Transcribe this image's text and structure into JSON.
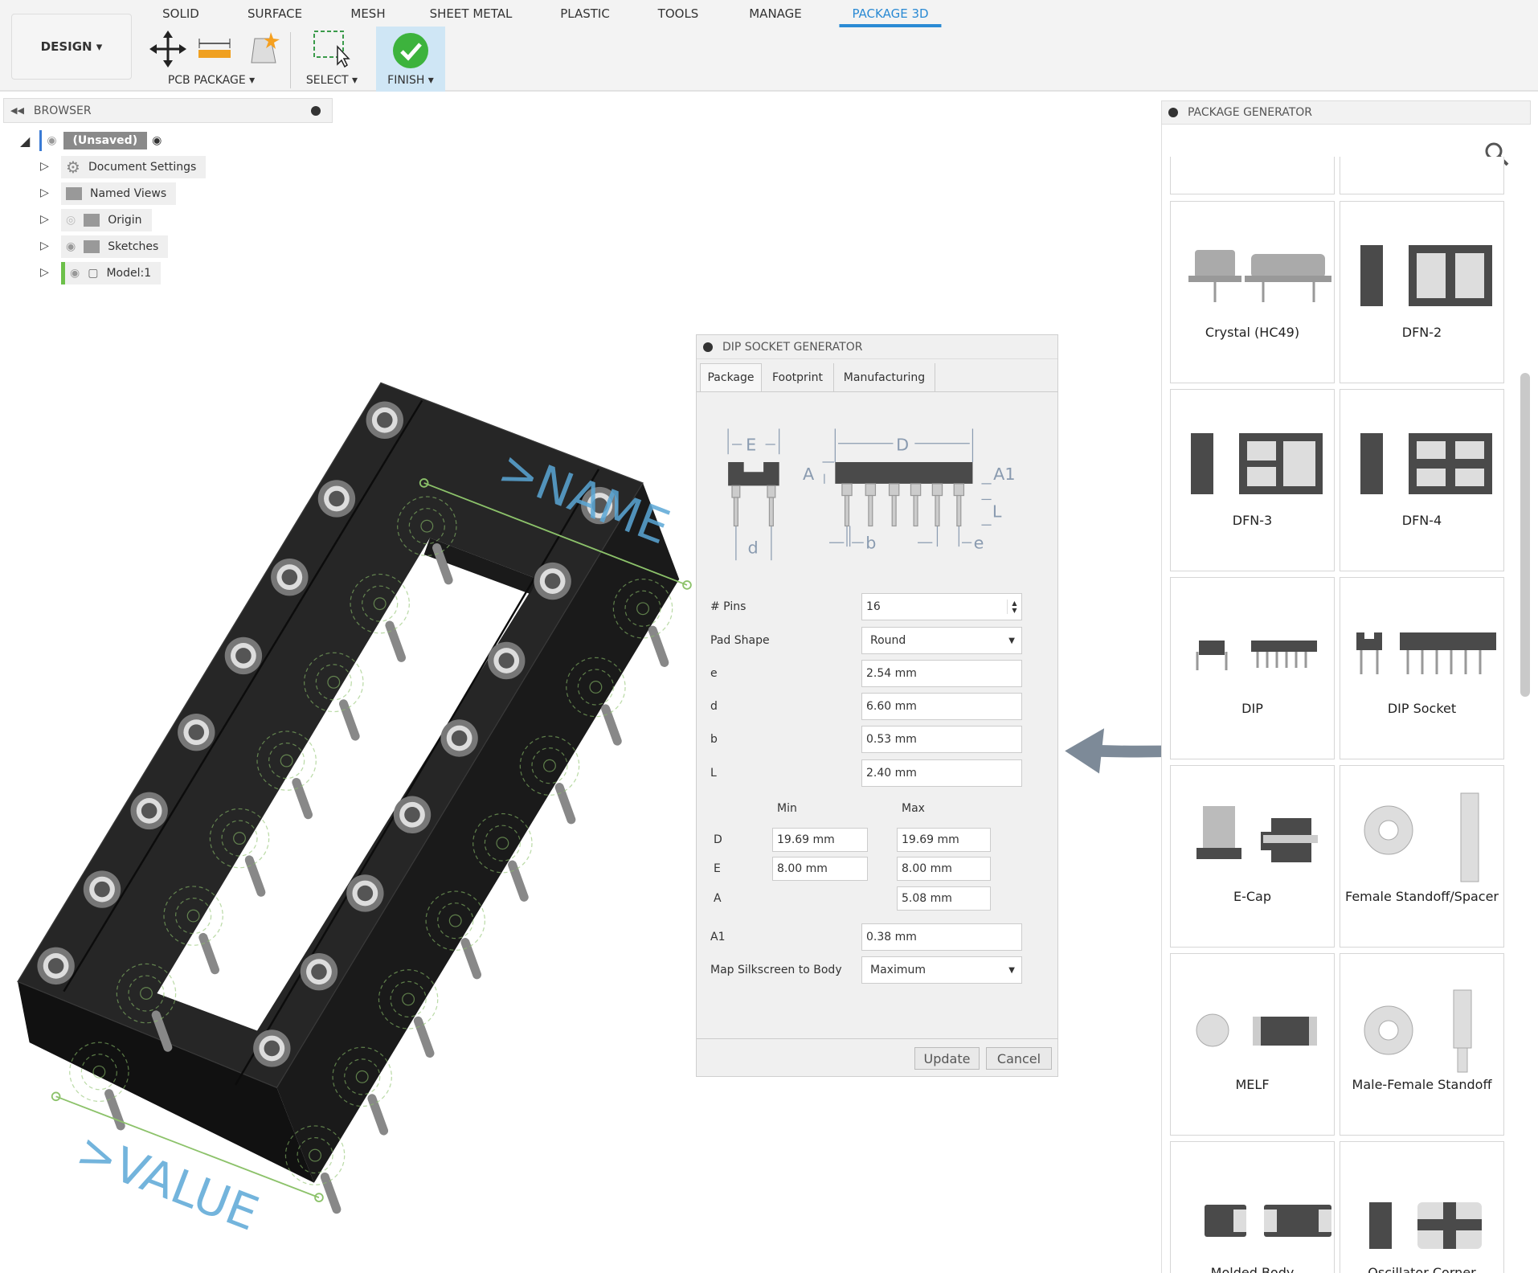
{
  "toolbar": {
    "tabs": [
      "SOLID",
      "SURFACE",
      "MESH",
      "SHEET METAL",
      "PLASTIC",
      "TOOLS",
      "MANAGE",
      "PACKAGE 3D"
    ],
    "active_tab": "PACKAGE 3D",
    "design_label": "DESIGN ▾",
    "groups": {
      "pcb_package": "PCB PACKAGE ▾",
      "select": "SELECT ▾",
      "finish": "FINISH ▾"
    }
  },
  "browser": {
    "title": "BROWSER",
    "root": "(Unsaved)",
    "items": [
      {
        "label": "Document Settings"
      },
      {
        "label": "Named Views"
      },
      {
        "label": "Origin"
      },
      {
        "label": "Sketches"
      },
      {
        "label": "Model:1"
      }
    ]
  },
  "viewport": {
    "name_label": ">NAME",
    "value_label": ">VALUE"
  },
  "dialog": {
    "title": "DIP SOCKET GENERATOR",
    "tabs": [
      "Package",
      "Footprint",
      "Manufacturing"
    ],
    "diagram_labels": {
      "E": "E",
      "d": "d",
      "D": "D",
      "A": "A",
      "A1": "A1",
      "L": "L",
      "b": "b",
      "e": "e"
    },
    "fields": {
      "pins": {
        "label": "# Pins",
        "value": "16"
      },
      "pad_shape": {
        "label": "Pad Shape",
        "value": "Round"
      },
      "e": {
        "label": "e",
        "value": "2.54 mm"
      },
      "d": {
        "label": "d",
        "value": "6.60 mm"
      },
      "b": {
        "label": "b",
        "value": "0.53 mm"
      },
      "L": {
        "label": "L",
        "value": "2.40 mm"
      }
    },
    "minmax": {
      "min_label": "Min",
      "max_label": "Max",
      "rows": [
        {
          "label": "D",
          "min": "19.69 mm",
          "max": "19.69 mm"
        },
        {
          "label": "E",
          "min": "8.00 mm",
          "max": "8.00 mm"
        },
        {
          "label": "A",
          "max": "5.08 mm"
        }
      ]
    },
    "A1": {
      "label": "A1",
      "value": "0.38 mm"
    },
    "silkscreen": {
      "label": "Map Silkscreen to Body",
      "value": "Maximum"
    },
    "update_label": "Update",
    "cancel_label": "Cancel"
  },
  "package_generator": {
    "title": "PACKAGE GENERATOR",
    "items": [
      "Crystal (HC49)",
      "DFN-2",
      "DFN-3",
      "DFN-4",
      "DIP",
      "DIP Socket",
      "E-Cap",
      "Female Standoff/Spacer",
      "MELF",
      "Male-Female Standoff",
      "Molded Body",
      "Oscillator Corner"
    ]
  },
  "colors": {
    "accent": "#2a8ad4",
    "finish": "#3db33d",
    "label_blue": "#5aa7d6",
    "sketch_green": "#8cc26a"
  }
}
